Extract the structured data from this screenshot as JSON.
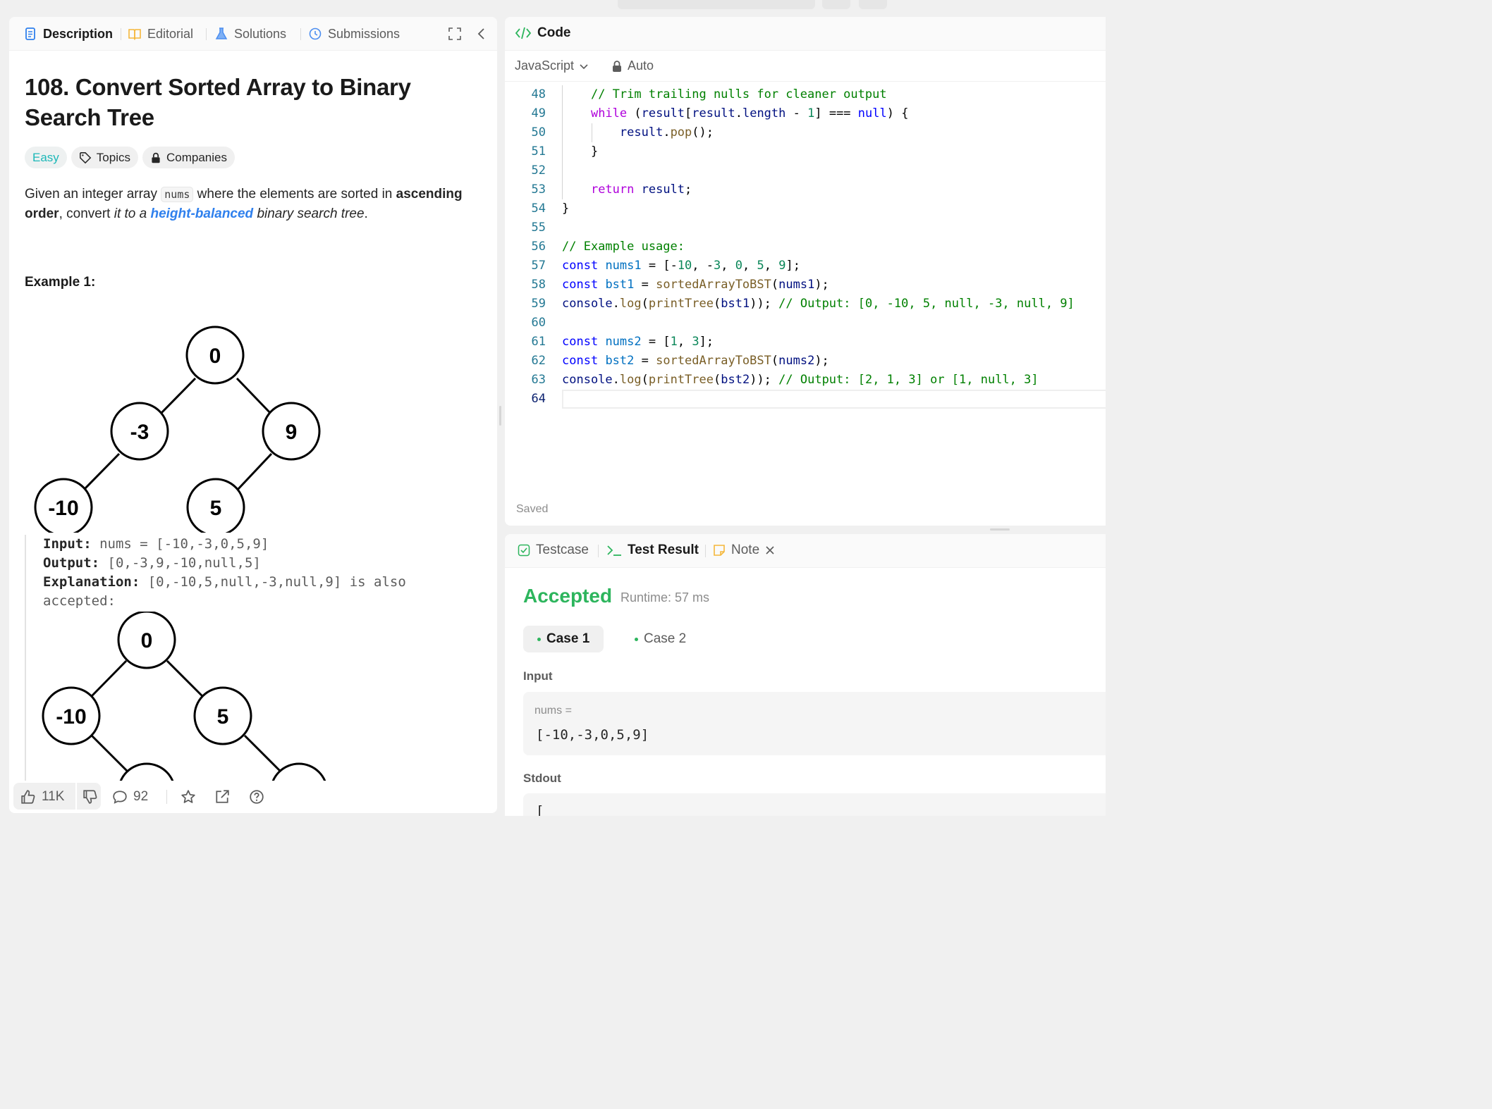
{
  "left": {
    "tabs": [
      "Description",
      "Editorial",
      "Solutions",
      "Submissions"
    ],
    "title": "108. Convert Sorted Array to Binary Search Tree",
    "tags": [
      "Easy",
      "Topics",
      "Companies"
    ],
    "desc": {
      "p1": "Given an integer array ",
      "code": "nums",
      "p2": " where the elements are sorted in ",
      "b1": "ascending order",
      "p3": ", convert ",
      "i1": "it to a ",
      "link": "height-balanced",
      "i2": " binary search tree",
      "p4": "."
    },
    "example_title": "Example 1:",
    "tree1": {
      "root": "0",
      "l": "-3",
      "r": "9",
      "ll": "-10",
      "rl": "5"
    },
    "input_label": "Input:",
    "input_val": " nums = [-10,-3,0,5,9]",
    "output_label": "Output:",
    "output_val": " [0,-3,9,-10,null,5]",
    "expl_label": "Explanation:",
    "expl_val": " [0,-10,5,null,-3,null,9] is also",
    "expl_val2": "accepted:",
    "tree2": {
      "root": "0",
      "l": "-10",
      "r": "5"
    },
    "footer": {
      "likes": "11K",
      "comments": "92"
    }
  },
  "code": {
    "header": "Code",
    "language": "JavaScript",
    "mode": "Auto",
    "saved": "Saved",
    "line_numbers": [
      "48",
      "49",
      "50",
      "51",
      "52",
      "53",
      "54",
      "55",
      "56",
      "57",
      "58",
      "59",
      "60",
      "61",
      "62",
      "63",
      "64"
    ]
  },
  "result": {
    "tabs": [
      "Testcase",
      "Test Result",
      "Note"
    ],
    "status": "Accepted",
    "runtime": "Runtime: 57 ms",
    "cases": [
      "Case 1",
      "Case 2"
    ],
    "input_label": "Input",
    "var_name": "nums =",
    "var_value": "[-10,-3,0,5,9]",
    "stdout_label": "Stdout",
    "stdout_value": "["
  },
  "colors": {
    "accepted": "#2db55d",
    "easy": "#1cb8b8",
    "link": "#2f80ed"
  }
}
